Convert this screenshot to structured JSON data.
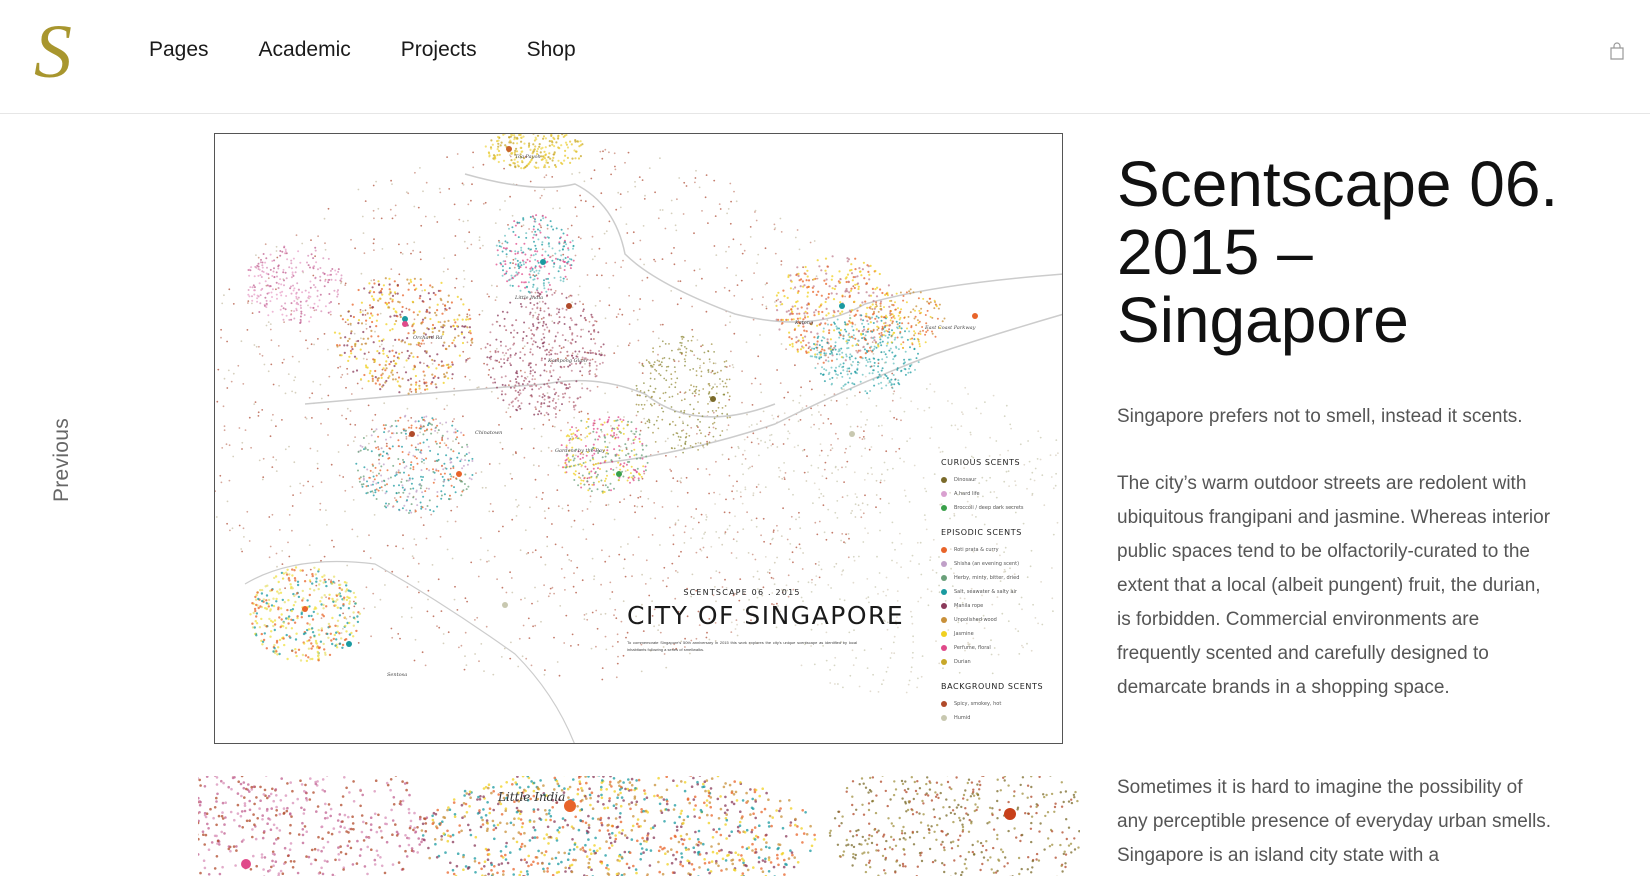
{
  "header": {
    "logo": "S",
    "nav": [
      {
        "label": "Pages"
      },
      {
        "label": "Academic"
      },
      {
        "label": "Projects"
      },
      {
        "label": "Shop"
      }
    ],
    "cart_icon": "shopping-bag-icon"
  },
  "side_nav": {
    "previous_label": "Previous"
  },
  "poster": {
    "subtitle": "SCENTSCAPE 06 . 2015",
    "title": "CITY OF SINGAPORE",
    "description": "To commemorate Singapore's 50th anniversary in 2015 this work explores the city's unique scentscape as identified by local inhabitants following a series of smellwalks.",
    "place_labels": [
      "Toa Payoh",
      "Little India",
      "Orchard Rd",
      "Kampong Glam",
      "Katong",
      "East Coast Parkway",
      "Chinatown",
      "Gardens by the Bay",
      "Sentosa"
    ],
    "legend": {
      "curious": {
        "heading": "CURIOUS SCENTS",
        "items": [
          {
            "label": "Dinosaur",
            "color": "#7a6a2a"
          },
          {
            "label": "A hard life",
            "color": "#d9a0d0"
          },
          {
            "label": "Broccoli / deep dark secrets",
            "color": "#3aa04a"
          }
        ]
      },
      "episodic": {
        "heading": "EPISODIC SCENTS",
        "items": [
          {
            "label": "Roti prata & curry",
            "color": "#e8642a"
          },
          {
            "label": "Shisha (an evening scent)",
            "color": "#c0a0c8"
          },
          {
            "label": "Herby, minty, bitter, dried",
            "color": "#6aa07a"
          },
          {
            "label": "Salt, seawater & salty air",
            "color": "#1a9aa0"
          },
          {
            "label": "Manila rope",
            "color": "#8a3a5a"
          },
          {
            "label": "Unpolished wood",
            "color": "#c8903a"
          },
          {
            "label": "Jasmine",
            "color": "#f0d020"
          },
          {
            "label": "Perfume, floral",
            "color": "#e04a8a"
          },
          {
            "label": "Durian",
            "color": "#c8a82a"
          }
        ]
      },
      "background": {
        "heading": "BACKGROUND SCENTS",
        "items": [
          {
            "label": "Spicy, smokey, hot",
            "color": "#b04a2a"
          },
          {
            "label": "Humid",
            "color": "#c8c8b0"
          }
        ]
      }
    },
    "strip_label": "Little India"
  },
  "article": {
    "title": "Scentscape 06. 2015 – Singapore",
    "intro": "Singapore prefers not to smell, instead it scents.",
    "paragraph_2": "The city’s warm outdoor streets are redolent with ubiquitous frangipani and jasmine. Whereas interior public spaces tend to be olfactorily-curated to the extent that a local (albeit pungent) fruit, the durian, is forbidden. Commercial environments are frequently scented and carefully designed to demarcate brands in a shopping space.",
    "paragraph_3": "Sometimes it is hard to imagine the possibility of any perceptible presence of everyday urban smells. Singapore is an island city state with a"
  }
}
